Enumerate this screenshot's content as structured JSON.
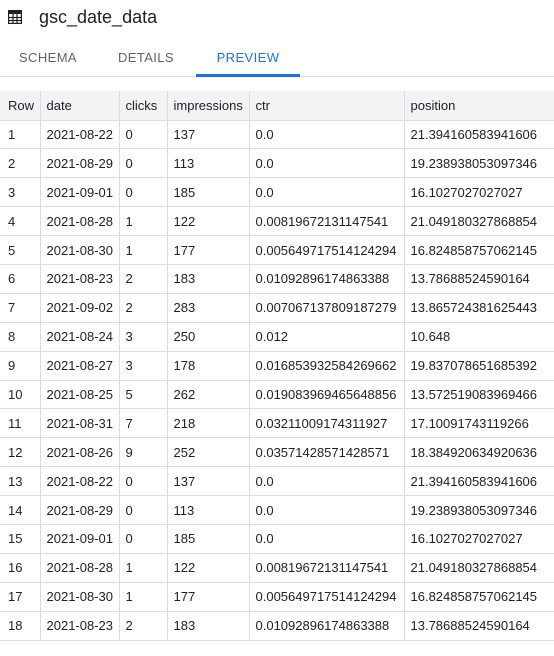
{
  "title": "gsc_date_data",
  "tabs": [
    {
      "label": "SCHEMA"
    },
    {
      "label": "DETAILS"
    },
    {
      "label": "PREVIEW",
      "active": true
    }
  ],
  "columns": [
    "Row",
    "date",
    "clicks",
    "impressions",
    "ctr",
    "position"
  ],
  "rows": [
    [
      "1",
      "2021-08-22",
      "0",
      "137",
      "0.0",
      "21.394160583941606"
    ],
    [
      "2",
      "2021-08-29",
      "0",
      "113",
      "0.0",
      "19.238938053097346"
    ],
    [
      "3",
      "2021-09-01",
      "0",
      "185",
      "0.0",
      "16.1027027027027"
    ],
    [
      "4",
      "2021-08-28",
      "1",
      "122",
      "0.00819672131147541",
      "21.049180327868854"
    ],
    [
      "5",
      "2021-08-30",
      "1",
      "177",
      "0.005649717514124294",
      "16.824858757062145"
    ],
    [
      "6",
      "2021-08-23",
      "2",
      "183",
      "0.01092896174863388",
      "13.78688524590164"
    ],
    [
      "7",
      "2021-09-02",
      "2",
      "283",
      "0.007067137809187279",
      "13.865724381625443"
    ],
    [
      "8",
      "2021-08-24",
      "3",
      "250",
      "0.012",
      "10.648"
    ],
    [
      "9",
      "2021-08-27",
      "3",
      "178",
      "0.016853932584269662",
      "19.837078651685392"
    ],
    [
      "10",
      "2021-08-25",
      "5",
      "262",
      "0.019083969465648856",
      "13.572519083969466"
    ],
    [
      "11",
      "2021-08-31",
      "7",
      "218",
      "0.03211009174311927",
      "17.10091743119266"
    ],
    [
      "12",
      "2021-08-26",
      "9",
      "252",
      "0.03571428571428571",
      "18.384920634920636"
    ],
    [
      "13",
      "2021-08-22",
      "0",
      "137",
      "0.0",
      "21.394160583941606"
    ],
    [
      "14",
      "2021-08-29",
      "0",
      "113",
      "0.0",
      "19.238938053097346"
    ],
    [
      "15",
      "2021-09-01",
      "0",
      "185",
      "0.0",
      "16.1027027027027"
    ],
    [
      "16",
      "2021-08-28",
      "1",
      "122",
      "0.00819672131147541",
      "21.049180327868854"
    ],
    [
      "17",
      "2021-08-30",
      "1",
      "177",
      "0.005649717514124294",
      "16.824858757062145"
    ],
    [
      "18",
      "2021-08-23",
      "2",
      "183",
      "0.01092896174863388",
      "13.78688524590164"
    ]
  ],
  "colors": {
    "accent": "#1a73e8",
    "header_bg": "#f1f3f4",
    "border": "#dadce0"
  },
  "icons": {
    "title": "table-icon"
  }
}
